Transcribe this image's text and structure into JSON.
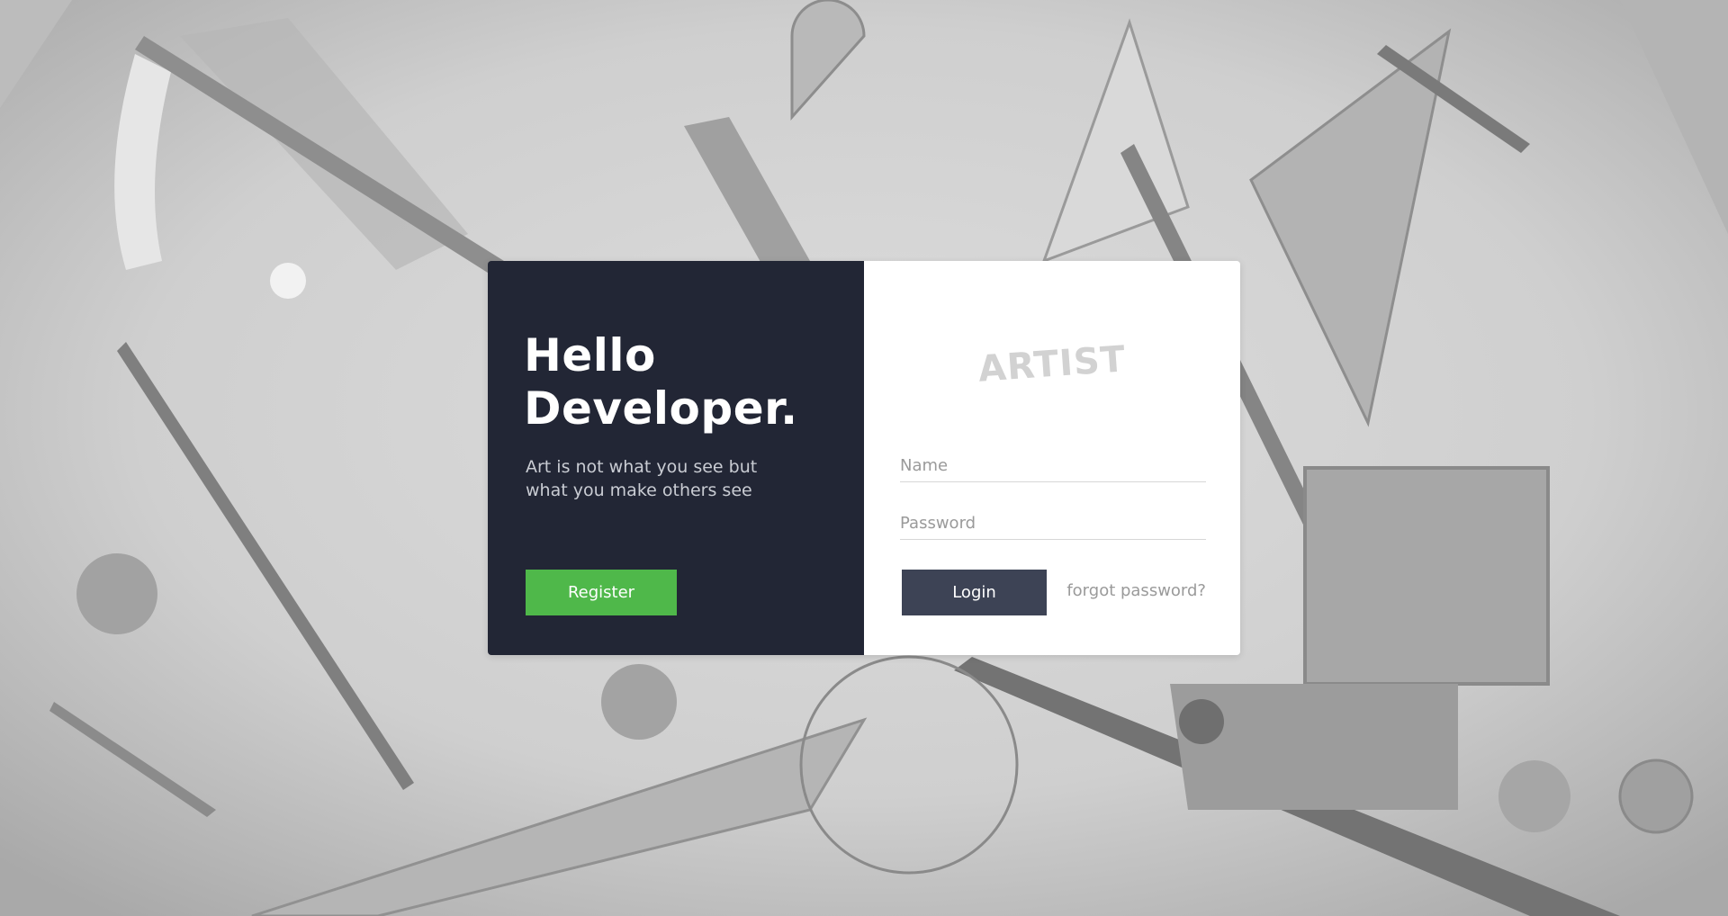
{
  "hero": {
    "heading_line1": "Hello",
    "heading_line2": "Developer.",
    "tagline": "Art is not what you see but what you make others see"
  },
  "register": {
    "label": "Register"
  },
  "brand": {
    "logo_text": "ARTIST"
  },
  "form": {
    "name_placeholder": "Name",
    "name_value": "",
    "password_placeholder": "Password",
    "password_value": "",
    "login_label": "Login",
    "forgot_label": "forgot password?"
  },
  "colors": {
    "left_panel": "#222635",
    "register_button": "#4fb84a",
    "login_button": "#3d4355",
    "background": "#c9c9c9"
  }
}
